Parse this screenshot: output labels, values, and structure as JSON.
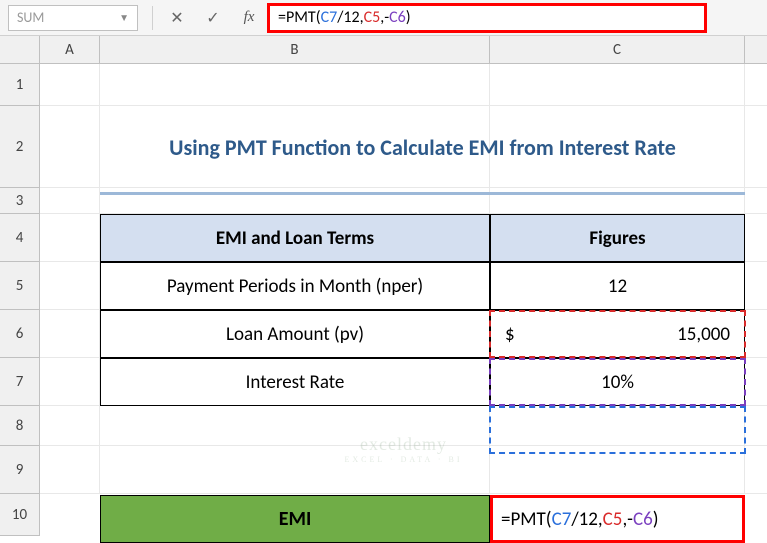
{
  "name_box": "SUM",
  "formula_bar": {
    "prefix": "=",
    "fn": "PMT",
    "open": "(",
    "ref1": "C7",
    "div": "/12,",
    "ref2": "C5",
    "comma": ",-",
    "ref3": "C6",
    "close": ")"
  },
  "columns": {
    "a": "A",
    "b": "B",
    "c": "C"
  },
  "rows": {
    "r1": "1",
    "r2": "2",
    "r3": "3",
    "r4": "4",
    "r5": "5",
    "r6": "6",
    "r7": "7",
    "r8": "8",
    "r9": "9",
    "r10": "10"
  },
  "title": "Using PMT Function to Calculate EMI from Interest Rate",
  "table": {
    "header_b": "EMI and Loan Terms",
    "header_c": "Figures",
    "rows": [
      {
        "label": "Payment Periods in Month (nper)",
        "value": "12"
      },
      {
        "label": "Loan Amount (pv)",
        "currency": "$",
        "value": "15,000"
      },
      {
        "label": "Interest Rate",
        "value": "10%"
      }
    ]
  },
  "emi": {
    "label": "EMI",
    "formula": {
      "prefix": "=",
      "fn": "PMT",
      "open": "(",
      "ref1": "C7",
      "div": "/12,",
      "ref2": "C5",
      "comma": ",-",
      "ref3": "C6",
      "close": ")"
    }
  },
  "watermark": {
    "main": "exceldemy",
    "sub": "EXCEL · DATA · BI"
  },
  "chart_data": {
    "type": "table",
    "title": "Using PMT Function to Calculate EMI from Interest Rate",
    "columns": [
      "EMI and Loan Terms",
      "Figures"
    ],
    "rows": [
      [
        "Payment Periods in Month (nper)",
        12
      ],
      [
        "Loan Amount (pv)",
        15000
      ],
      [
        "Interest Rate",
        "10%"
      ]
    ],
    "result_cell": {
      "label": "EMI",
      "formula": "=PMT(C7/12,C5,-C6)"
    }
  }
}
